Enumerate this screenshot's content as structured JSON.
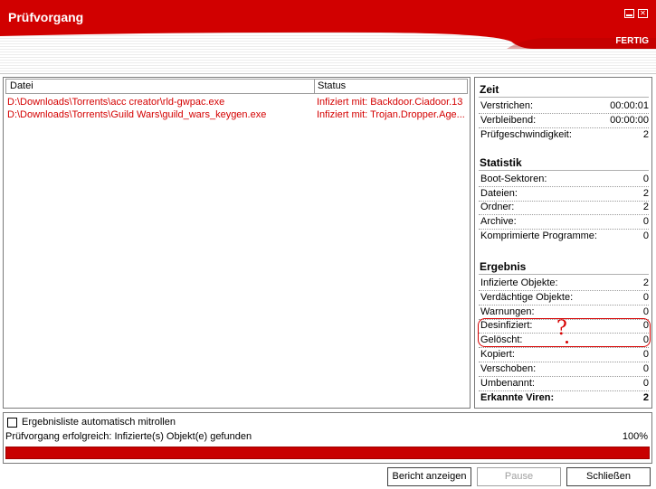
{
  "window": {
    "title": "Prüfvorgang",
    "state_label": "FERTIG",
    "accent_color": "#d10000"
  },
  "list": {
    "columns": [
      "Datei",
      "Status"
    ],
    "rows": [
      {
        "file": "D:\\Downloads\\Torrents\\acc creator\\rld-gwpac.exe",
        "status": "Infiziert mit: Backdoor.Ciadoor.13"
      },
      {
        "file": "D:\\Downloads\\Torrents\\Guild Wars\\guild_wars_keygen.exe",
        "status": "Infiziert mit: Trojan.Dropper.Age..."
      }
    ]
  },
  "zeit": {
    "title": "Zeit",
    "items": [
      {
        "label": "Verstrichen:",
        "value": "00:00:01"
      },
      {
        "label": "Verbleibend:",
        "value": "00:00:00"
      },
      {
        "label": "Prüfgeschwindigkeit:",
        "value": "2"
      }
    ]
  },
  "statistik": {
    "title": "Statistik",
    "items": [
      {
        "label": "Boot-Sektoren:",
        "value": "0"
      },
      {
        "label": "Dateien:",
        "value": "2"
      },
      {
        "label": "Ordner:",
        "value": "2"
      },
      {
        "label": "Archive:",
        "value": "0"
      },
      {
        "label": "Komprimierte Programme:",
        "value": "0"
      }
    ]
  },
  "ergebnis": {
    "title": "Ergebnis",
    "items": [
      {
        "label": "Infizierte Objekte:",
        "value": "2"
      },
      {
        "label": "Verdächtige Objekte:",
        "value": "0"
      },
      {
        "label": "Warnungen:",
        "value": "0"
      },
      {
        "label": "Desinfiziert:",
        "value": "0"
      },
      {
        "label": "Gelöscht:",
        "value": "0"
      },
      {
        "label": "Kopiert:",
        "value": "0"
      },
      {
        "label": "Verschoben:",
        "value": "0"
      },
      {
        "label": "Umbenannt:",
        "value": "0"
      },
      {
        "label": "Erkannte Viren:",
        "value": "2"
      }
    ]
  },
  "annotation": {
    "mark": "?"
  },
  "bottom": {
    "autoscroll_label": "Ergebnisliste automatisch mitrollen",
    "autoscroll_checked": false,
    "status_text": "Prüfvorgang erfolgreich: Infizierte(s) Objekt(e) gefunden",
    "progress_label": "100%",
    "progress_percent": 100
  },
  "buttons": {
    "report": "Bericht anzeigen",
    "pause": "Pause",
    "close": "Schließen"
  }
}
